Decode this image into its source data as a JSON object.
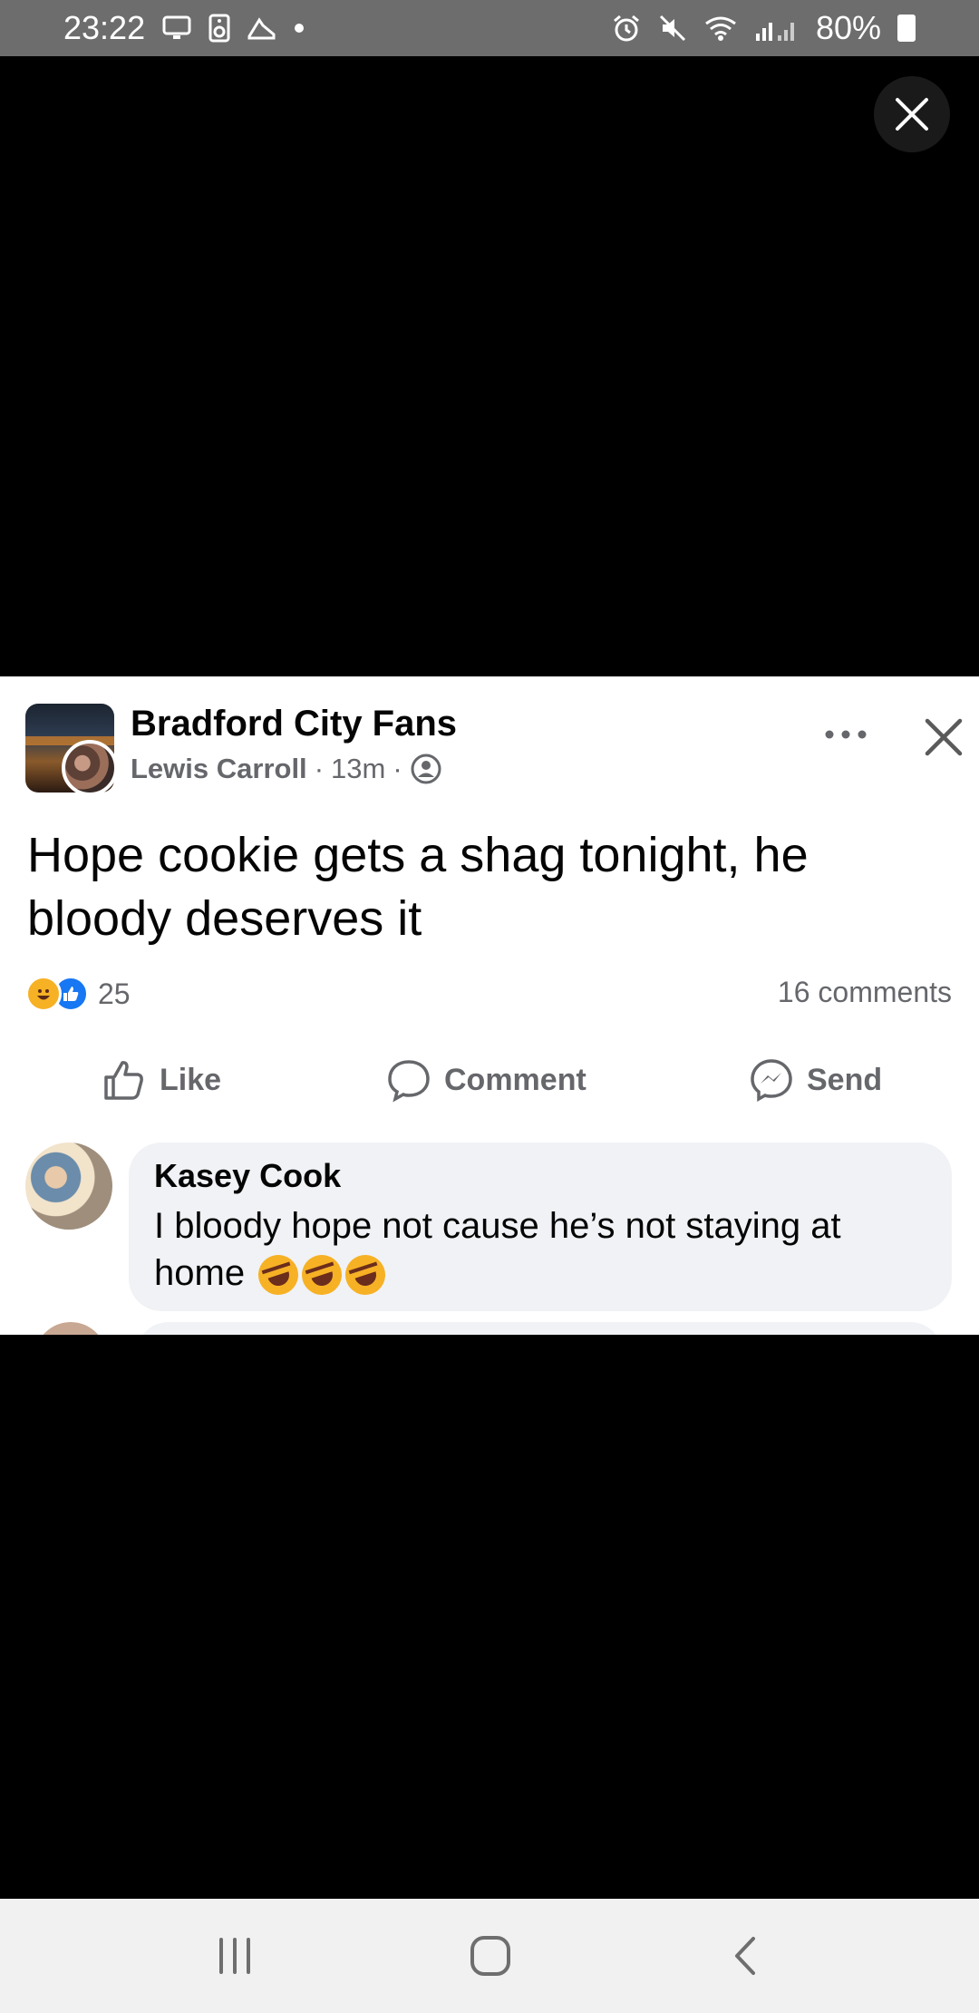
{
  "status_bar": {
    "time": "23:22",
    "battery": "80%"
  },
  "post": {
    "group_name": "Bradford City Fans",
    "author": "Lewis Carroll",
    "time": "13m",
    "separator": "·",
    "text": "Hope cookie gets a shag tonight, he bloody deserves it",
    "reaction_count": "25",
    "comment_count": "16 comments"
  },
  "actions": {
    "like": "Like",
    "comment": "Comment",
    "send": "Send"
  },
  "comment": {
    "name": "Kasey Cook",
    "text": "I bloody hope not cause he’s not staying at home"
  },
  "colors": {
    "accent": "#1877f2",
    "haha": "#f7b125",
    "muted_text": "#65676b",
    "bubble": "#f0f2f5"
  }
}
